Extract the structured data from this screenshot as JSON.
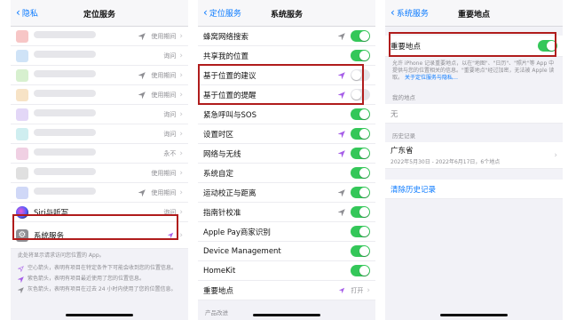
{
  "colors": {
    "accent": "#0a7aff",
    "toggle_on": "#34c759",
    "highlight_border": "#b01c1c",
    "arrow_purple": "#a65ee8",
    "arrow_gray": "#8e8e93"
  },
  "panel1": {
    "back_label": "隐私",
    "title": "定位服务",
    "rows": [
      {
        "value": "使用期间",
        "icon": "location-arrow-icon"
      },
      {
        "value": "询问",
        "icon": ""
      },
      {
        "value": "使用期间",
        "icon": "location-arrow-icon"
      },
      {
        "value": "使用期间",
        "icon": "location-arrow-icon"
      },
      {
        "value": "询问",
        "icon": ""
      },
      {
        "value": "询问",
        "icon": ""
      },
      {
        "value": "永不",
        "icon": ""
      },
      {
        "value": "使用期间",
        "icon": ""
      },
      {
        "value": "使用期间",
        "icon": "location-arrow-icon"
      }
    ],
    "siri_label": "Siri与听写",
    "siri_value": "询问",
    "system_label": "系统服务",
    "footer_system": "此处将显示请求访问您位置的 App。",
    "notes": [
      "空心箭头，表明有项目在特定条件下可能会收到您的位置信息。",
      "紫色箭头，表明有项目最近使用了您的位置信息。",
      "灰色箭头，表明有项目在过去 24 小时内使用了您的位置信息。"
    ]
  },
  "panel2": {
    "back_label": "定位服务",
    "title": "系统服务",
    "rows": [
      {
        "label": "蜂窝网络搜索",
        "toggle": true,
        "arrow": "gray"
      },
      {
        "label": "共享我的位置",
        "toggle": true,
        "arrow": ""
      },
      {
        "label": "基于位置的建议",
        "toggle": false,
        "arrow": "purple"
      },
      {
        "label": "基于位置的提醒",
        "toggle": false,
        "arrow": "purple"
      },
      {
        "label": "紧急呼叫与SOS",
        "toggle": true,
        "arrow": ""
      },
      {
        "label": "设置时区",
        "toggle": true,
        "arrow": "purple"
      },
      {
        "label": "网络与无线",
        "toggle": true,
        "arrow": "purple"
      },
      {
        "label": "系统自定",
        "toggle": true,
        "arrow": ""
      },
      {
        "label": "运动校正与距离",
        "toggle": true,
        "arrow": "gray"
      },
      {
        "label": "指南针校准",
        "toggle": true,
        "arrow": "gray"
      },
      {
        "label": "Apple Pay商家识别",
        "toggle": true,
        "arrow": ""
      },
      {
        "label": "Device Management",
        "toggle": true,
        "arrow": ""
      },
      {
        "label": "HomeKit",
        "toggle": true,
        "arrow": ""
      }
    ],
    "significant_label": "重要地点",
    "significant_value": "打开",
    "section_footer": "产品改进"
  },
  "panel3": {
    "back_label": "系统服务",
    "title": "重要地点",
    "toggle_label": "重要地点",
    "description": "允许 iPhone 记录重要地点，以在\"地图\"、\"日历\"、\"照片\"等 App 中提供与您的位置相关的信息。\"重要地点\"经过加密，无法被 Apple 读取。",
    "link_text": "关于定位服务与隐私…",
    "my_location_header": "我的地点",
    "none_text": "无",
    "history_header": "历史记录",
    "history_title": "广东省",
    "history_sub": "2022年5月30日 - 2022年6月17日，6个地点",
    "clear_label": "清除历史记录"
  }
}
